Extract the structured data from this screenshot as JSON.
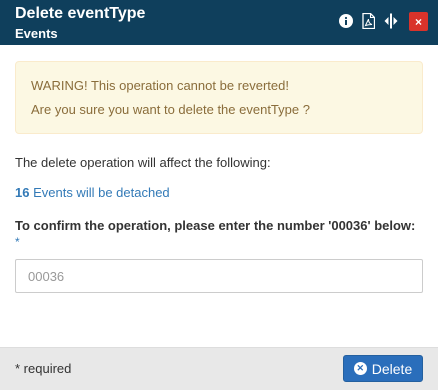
{
  "dialog": {
    "title": "Delete eventType",
    "subtitle": "Events",
    "close_label": "×",
    "toolbar_icons": [
      "info-icon",
      "pdf-icon",
      "resize-icon",
      "close-icon"
    ]
  },
  "warning": {
    "line1": "WARING! This operation cannot be reverted!",
    "line2": "Are you sure you want to delete the eventType ?"
  },
  "affect_text": "The delete operation will affect the following:",
  "detached": {
    "count": "16",
    "text": " Events will be detached"
  },
  "confirm": {
    "label": "To confirm the operation, please enter the number '00036' below:",
    "required_mark": "*",
    "placeholder": "00036"
  },
  "footer": {
    "required_note": "* required",
    "delete_label": "Delete"
  },
  "colors": {
    "titlebar": "#0f3f5c",
    "close": "#d9332b",
    "warning_bg": "#fcf8e3",
    "warning_text": "#8a6d3b",
    "link": "#337ab7",
    "primary": "#2a6ebb",
    "footer_bg": "#e8e8e8"
  }
}
